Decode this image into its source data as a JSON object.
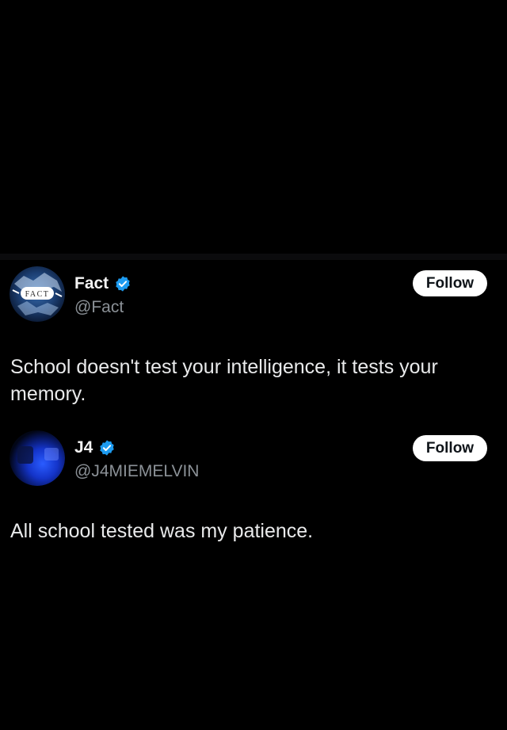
{
  "posts": [
    {
      "display_name": "Fact",
      "handle": "@Fact",
      "verified": true,
      "follow_label": "Follow",
      "text": "School doesn't test your intelligence, it tests your memory.",
      "avatar": {
        "icon": "fact-logo-avatar",
        "logo_letters": "FACT"
      }
    },
    {
      "display_name": "J4",
      "handle": "@J4MIEMELVIN",
      "verified": true,
      "follow_label": "Follow",
      "text": "All school tested was my patience.",
      "avatar": {
        "icon": "blue-glow-avatar"
      }
    }
  ],
  "colors": {
    "background": "#000000",
    "verified_badge": "#1d9bf0",
    "handle_text": "#8b9197",
    "follow_button_bg": "#ffffff",
    "follow_button_text": "#0f1419"
  }
}
